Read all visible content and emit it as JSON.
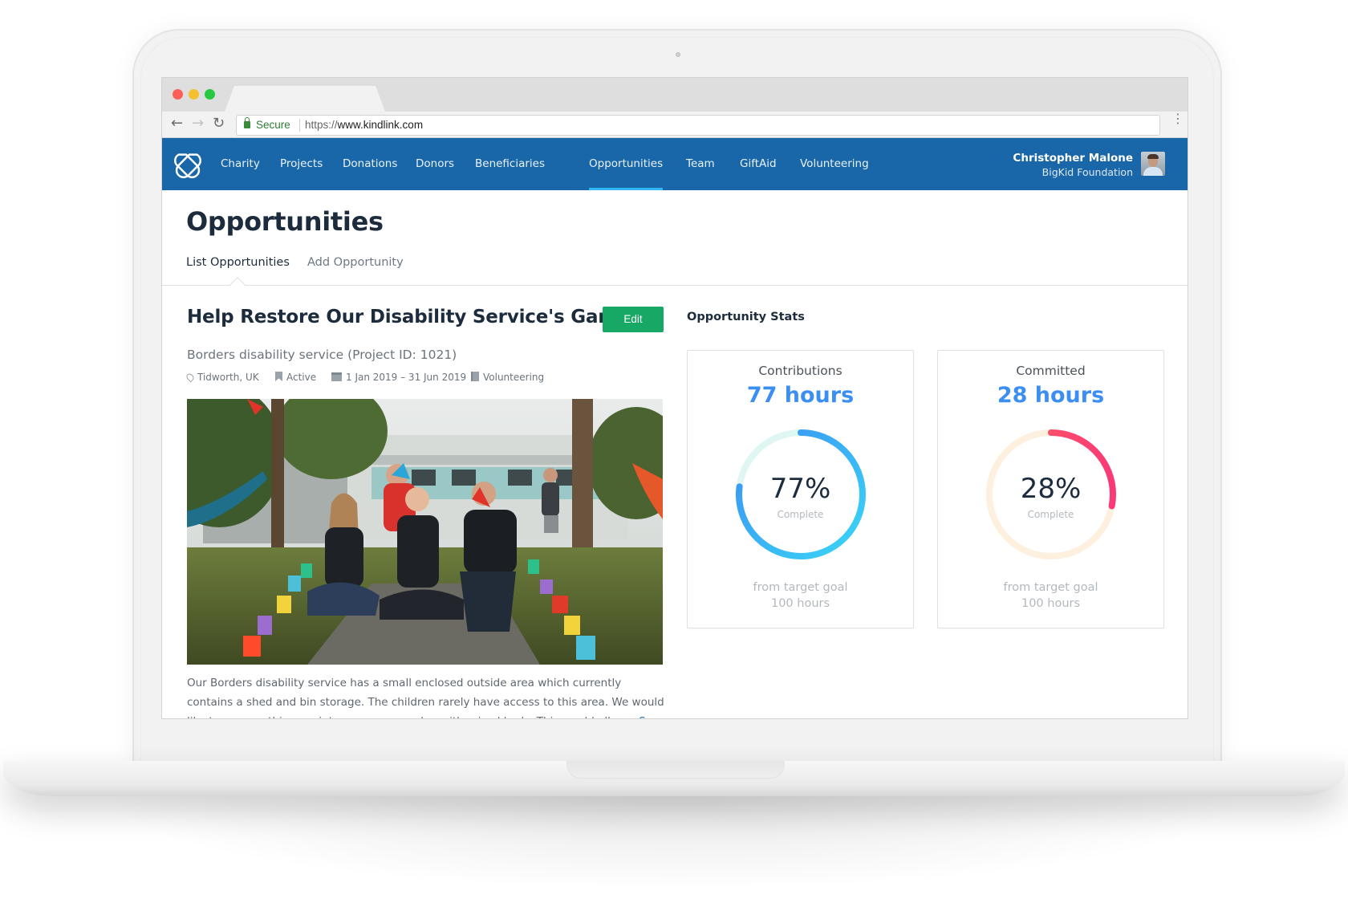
{
  "browser": {
    "secure_label": "Secure",
    "url_scheme": "https://",
    "url_host": "www.kindlink.com"
  },
  "nav": {
    "items": [
      {
        "label": "Charity"
      },
      {
        "label": "Projects"
      },
      {
        "label": "Donations"
      },
      {
        "label": "Donors"
      },
      {
        "label": "Beneficiaries"
      },
      {
        "label": "Opportunities",
        "active": true
      },
      {
        "label": "Team"
      },
      {
        "label": "GiftAid"
      },
      {
        "label": "Volunteering"
      }
    ],
    "user_name": "Christopher Malone",
    "user_org": "BigKid Foundation"
  },
  "page": {
    "title": "Opportunities",
    "tabs": [
      {
        "label": "List Opportunities",
        "active": true
      },
      {
        "label": "Add Opportunity"
      }
    ]
  },
  "opportunity": {
    "title": "Help Restore Our Disability Service's Garden",
    "edit_label": "Edit",
    "project_line": "Borders disability service (Project ID: 1021)",
    "location": "Tidworth, UK",
    "status": "Active",
    "dates": "1 Jan 2019 – 31 Jun 2019",
    "category": "Volunteering",
    "description": "Our Borders disability service has a small enclosed outside area which currently contains a shed and bin storage. The children rarely have access to this area. We would like to revamp this area into a sensory garden with raised beds. This would allow...",
    "see_more": "See more"
  },
  "stats": {
    "title": "Opportunity Stats",
    "cards": [
      {
        "label": "Contributions",
        "value": "77 hours",
        "percent": 77,
        "percent_label": "77%",
        "complete_label": "Complete",
        "goal_label": "from target goal",
        "goal_value": "100 hours",
        "colors": {
          "track": "#dff7f3",
          "start": "#3ad6f7",
          "end": "#3b8ff2"
        }
      },
      {
        "label": "Committed",
        "value": "28 hours",
        "percent": 28,
        "percent_label": "28%",
        "complete_label": "Complete",
        "goal_label": "from target goal",
        "goal_value": "100 hours",
        "colors": {
          "track": "#fdf0de",
          "start": "#ff5f5f",
          "end": "#f83a77"
        }
      }
    ]
  },
  "colors": {
    "nav_bg": "#1967a8",
    "active_indicator": "#2fb8f5",
    "edit_button": "#17a865",
    "stat_value": "#3b8ff2"
  }
}
